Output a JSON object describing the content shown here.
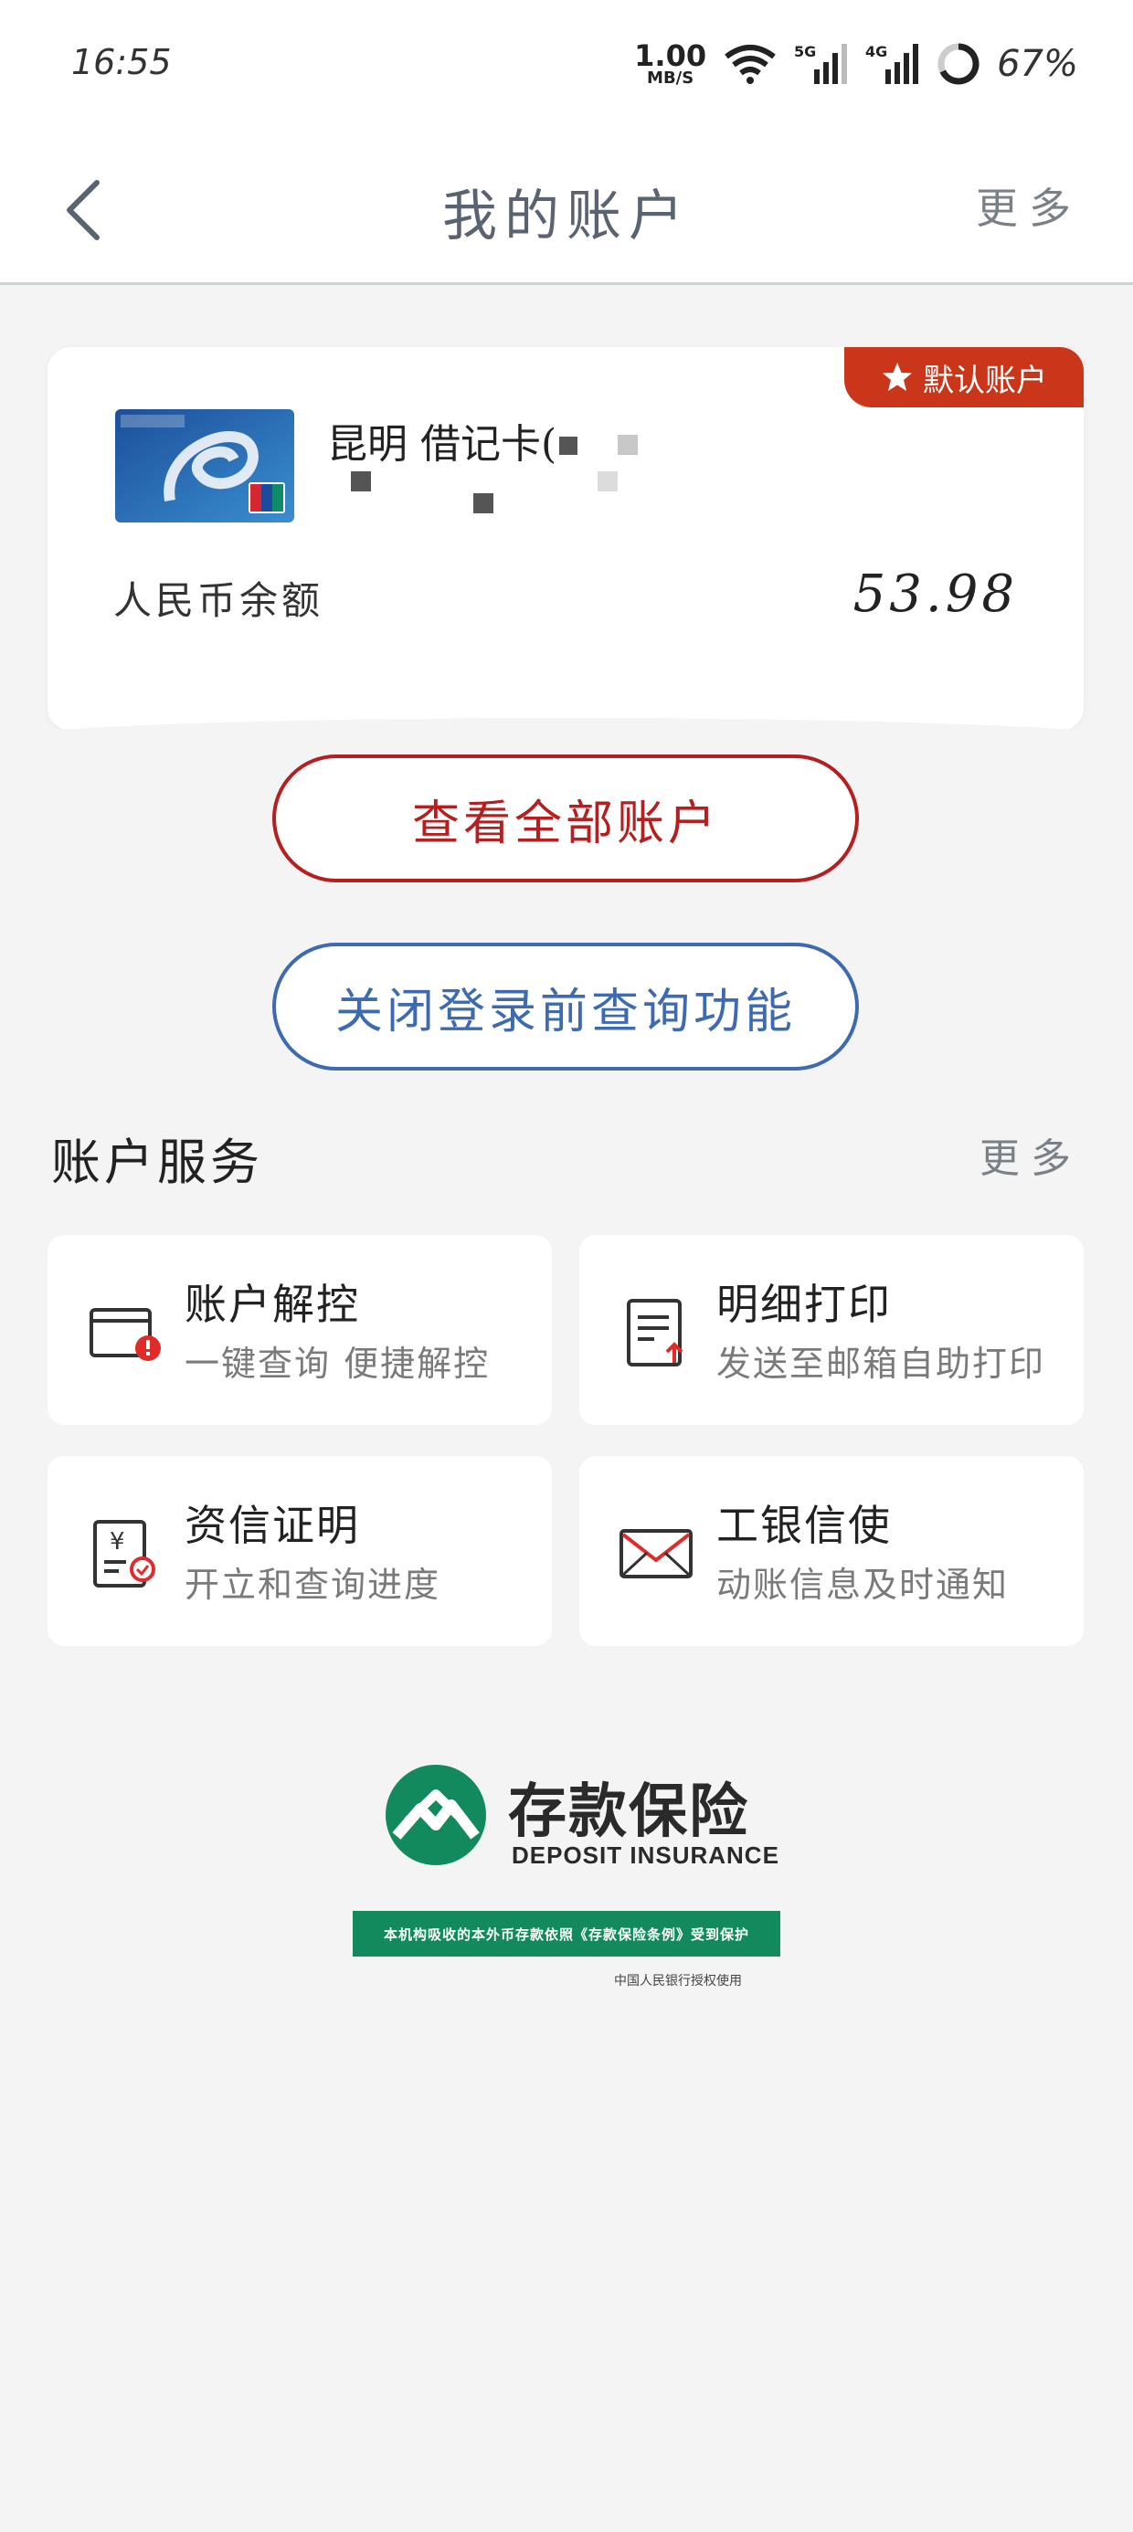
{
  "status_bar": {
    "time": "16:55",
    "net_speed_value": "1.00",
    "net_speed_unit": "MB/S",
    "signal_1": "5G",
    "signal_2": "4G",
    "battery": "67%"
  },
  "header": {
    "title": "我的账户",
    "more": "更多",
    "back_icon": "chevron-left-icon"
  },
  "account_card": {
    "badge": "默认账户",
    "badge_icon": "star-icon",
    "card_name": "昆明 借记卡(",
    "balance_label": "人民币余额",
    "balance_value": "53.98"
  },
  "buttons": {
    "view_all": "查看全部账户",
    "close_query": "关闭登录前查询功能"
  },
  "services": {
    "title": "账户服务",
    "more": "更多",
    "items": [
      {
        "title": "账户解控",
        "subtitle": "一键查询 便捷解控",
        "icon": "card-alert-icon"
      },
      {
        "title": "明细打印",
        "subtitle": "发送至邮箱自助打印",
        "icon": "document-upload-icon"
      },
      {
        "title": "资信证明",
        "subtitle": "开立和查询进度",
        "icon": "yuan-certificate-icon"
      },
      {
        "title": "工银信使",
        "subtitle": "动账信息及时通知",
        "icon": "envelope-icon"
      }
    ]
  },
  "deposit_insurance": {
    "cn": "存款保险",
    "en": "DEPOSIT INSURANCE",
    "banner": "本机构吸收的本外币存款依照《存款保险条例》受到保护",
    "authorization": "中国人民银行授权使用"
  },
  "colors": {
    "accent_red": "#b51f1f",
    "accent_blue": "#3d6ab0",
    "badge_red": "#c9361a",
    "deposit_green": "#138a5e"
  }
}
